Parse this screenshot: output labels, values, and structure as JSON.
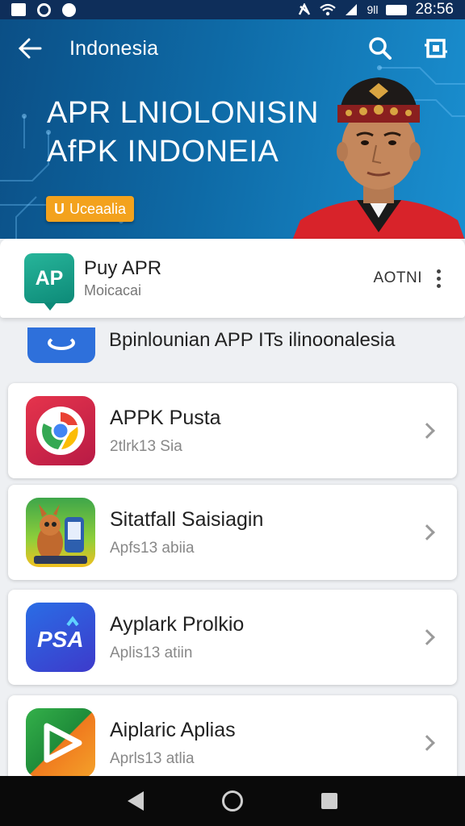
{
  "status_bar": {
    "time": "28:56",
    "network": "9ll"
  },
  "header": {
    "title": "Indonesia",
    "hero_line1": "APR LNIOLONISIN",
    "hero_line2": "AfPK INDONEIA",
    "badge_label": "Uceaalia",
    "badge_prefix": "U"
  },
  "app_info": {
    "logo_text": "AP",
    "name": "Puy APR",
    "subtitle": "Moicacai",
    "action": "AOTNI"
  },
  "section": {
    "heading": "Bpinlounian APP ITs ilinoonalesia"
  },
  "apps": [
    {
      "name": "APPK Pusta",
      "sub": "2tlrk13 Sia",
      "icon": "chrome-like-icon"
    },
    {
      "name": "Sitatfall Saisiagin",
      "sub": "Apfs13 abiia",
      "icon": "cartoon-squirrel-icon"
    },
    {
      "name": "Ayplark Prolkio",
      "sub": "Aplis13 atiin",
      "icon": "psat-icon",
      "icon_text": "PSA"
    },
    {
      "name": "Aiplaric Aplias",
      "sub": "Aprls13 atlia",
      "icon": "play-icon"
    }
  ],
  "colors": {
    "hero": "#0e6aa6",
    "badge": "#f3a21d",
    "app_logo": "#1a9e88"
  }
}
